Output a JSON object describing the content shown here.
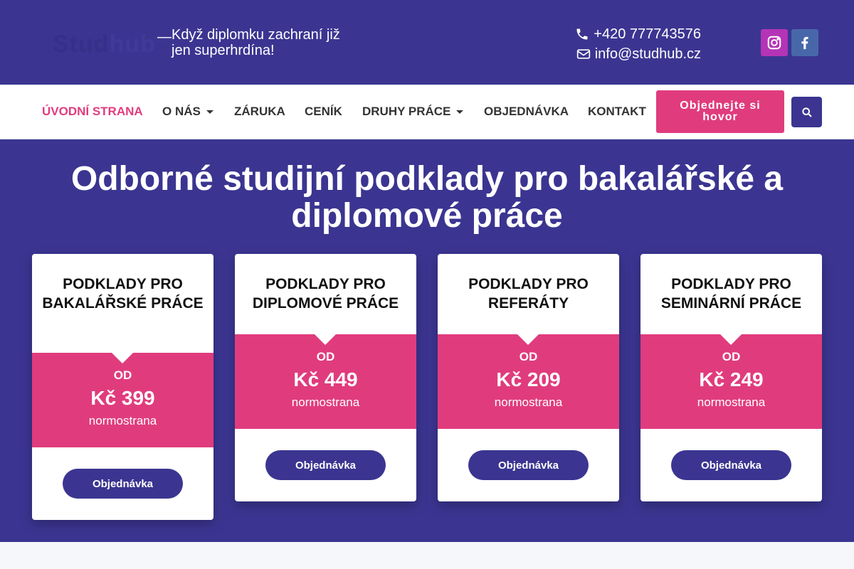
{
  "header": {
    "logo": {
      "part1": "Stud",
      "part2": "hub"
    },
    "dash": "—",
    "tagline": "Když diplomku zachraní již jen superhrdína!",
    "phone": "+420 777743576",
    "email": "info@studhub.cz",
    "phone_icon": "phone-icon",
    "email_icon": "envelope-icon",
    "social": [
      {
        "name": "instagram-icon",
        "color": "#b434b6"
      },
      {
        "name": "facebook-icon",
        "color": "#4867aa"
      }
    ]
  },
  "nav": {
    "items": [
      {
        "label": "ÚVODNÍ STRANA",
        "active": true
      },
      {
        "label": "O NÁS",
        "dropdown": true
      },
      {
        "label": "ZÁRUKA"
      },
      {
        "label": "CENÍK"
      },
      {
        "label": "DRUHY PRÁCE",
        "dropdown": true
      },
      {
        "label": "OBJEDNÁVKA"
      },
      {
        "label": "KONTAKT"
      }
    ],
    "cta": "Objednejte si hovor",
    "search_icon": "search-icon"
  },
  "hero": {
    "title": "Odborné studijní podklady pro bakalářské a diplomové práce"
  },
  "cards": [
    {
      "title": "PODKLADY PRO BAKALÁŘSKÉ PRÁCE",
      "od": "OD",
      "price": "Kč 399",
      "unit": "normostrana",
      "button": "Objednávka"
    },
    {
      "title": "PODKLADY PRO DIPLOMOVÉ PRÁCE",
      "od": "OD",
      "price": "Kč 449",
      "unit": "normostrana",
      "button": "Objednávka"
    },
    {
      "title": "PODKLADY PRO REFERÁTY",
      "od": "OD",
      "price": "Kč 209",
      "unit": "normostrana",
      "button": "Objednávka"
    },
    {
      "title": "PODKLADY PRO SEMINÁRNÍ PRÁCE",
      "od": "OD",
      "price": "Kč 249",
      "unit": "normostrana",
      "button": "Objednávka"
    }
  ],
  "colors": {
    "primary": "#3b3591",
    "accent": "#e03c7d",
    "white": "#ffffff"
  }
}
